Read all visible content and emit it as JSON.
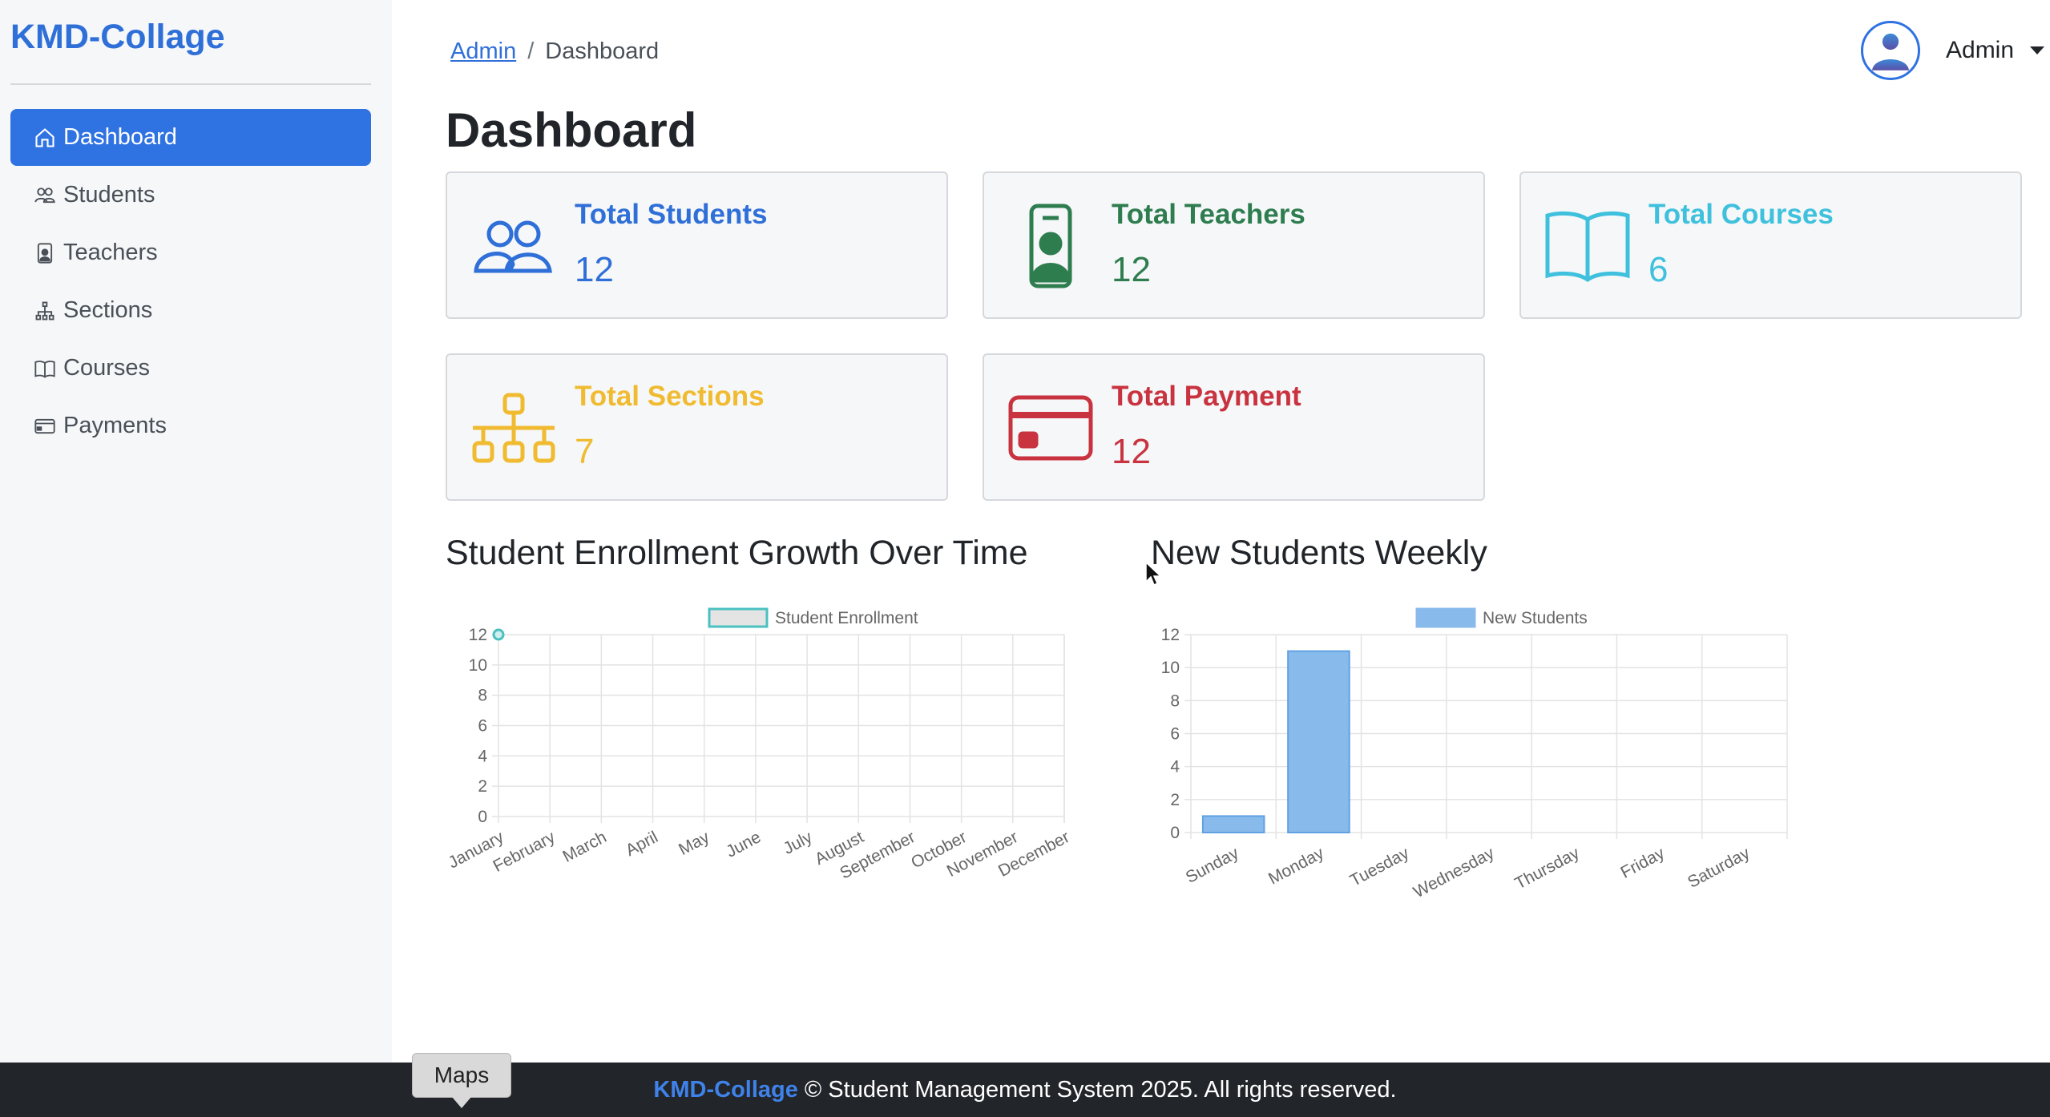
{
  "app": {
    "brand": "KMD-Collage"
  },
  "sidebar": {
    "items": [
      {
        "label": "Dashboard",
        "icon": "home-icon"
      },
      {
        "label": "Students",
        "icon": "people-icon"
      },
      {
        "label": "Teachers",
        "icon": "badge-icon"
      },
      {
        "label": "Sections",
        "icon": "diagram-icon"
      },
      {
        "label": "Courses",
        "icon": "book-icon"
      },
      {
        "label": "Payments",
        "icon": "credit-card-icon"
      }
    ]
  },
  "header": {
    "breadcrumb": {
      "root": "Admin",
      "separator": "/",
      "current": "Dashboard"
    },
    "user": {
      "name": "Admin"
    }
  },
  "page": {
    "title": "Dashboard"
  },
  "cards": [
    {
      "title": "Total Students",
      "value": "12",
      "icon": "people-icon",
      "color": "#2f6fd8"
    },
    {
      "title": "Total Teachers",
      "value": "12",
      "icon": "badge-icon",
      "color": "#2e7d4f"
    },
    {
      "title": "Total Courses",
      "value": "6",
      "icon": "book-icon",
      "color": "#3fc1dd"
    },
    {
      "title": "Total Sections",
      "value": "7",
      "icon": "diagram-icon",
      "color": "#f0bb30"
    },
    {
      "title": "Total Payment",
      "value": "12",
      "icon": "credit-card-icon",
      "color": "#c8333f"
    }
  ],
  "charts": {
    "enrollment_title": "Student Enrollment Growth Over Time",
    "weekly_title": "New Students Weekly"
  },
  "chart_data": [
    {
      "type": "line",
      "title": "Student Enrollment Growth Over Time",
      "categories": [
        "January",
        "February",
        "March",
        "April",
        "May",
        "June",
        "July",
        "August",
        "September",
        "October",
        "November",
        "December"
      ],
      "series": [
        {
          "name": "Student Enrollment",
          "values": [
            12,
            null,
            null,
            null,
            null,
            null,
            null,
            null,
            null,
            null,
            null,
            null
          ]
        }
      ],
      "yticks": [
        0,
        2,
        4,
        6,
        8,
        10,
        12
      ],
      "ylim": [
        0,
        12
      ],
      "grid": true,
      "legend": "top",
      "color": "#4bc0c0"
    },
    {
      "type": "bar",
      "title": "New Students Weekly",
      "categories": [
        "Sunday",
        "Monday",
        "Tuesday",
        "Wednesday",
        "Thursday",
        "Friday",
        "Saturday"
      ],
      "series": [
        {
          "name": "New Students",
          "values": [
            1,
            11,
            0,
            0,
            0,
            0,
            0
          ]
        }
      ],
      "yticks": [
        0,
        2,
        4,
        6,
        8,
        10,
        12
      ],
      "ylim": [
        0,
        12
      ],
      "grid": true,
      "legend": "top",
      "color": "#88bbec"
    }
  ],
  "footer": {
    "brand": "KMD-Collage",
    "text": "© Student Management System 2025. All rights reserved."
  },
  "tooltip": {
    "text": "Maps"
  }
}
